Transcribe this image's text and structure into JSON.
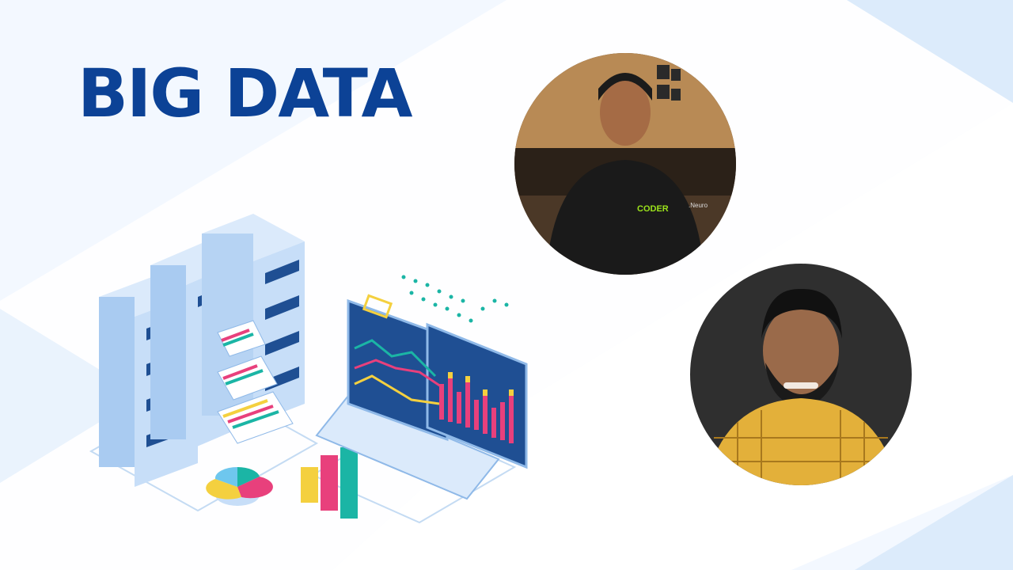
{
  "slide": {
    "title": "BIG DATA",
    "title_color": "#0c4296",
    "background_color": "#f3f8ff",
    "accent_band_color": "#dcebfb"
  },
  "illustration": {
    "subject": "server racks, laptop with line and bar charts, pie chart and 3D bar chart",
    "colors": {
      "server": "#bfd9f5",
      "server_dark": "#8fb9e8",
      "screen": "#1f4f93",
      "pink": "#e8407c",
      "teal": "#1bb5a5",
      "yellow": "#f4d03f"
    }
  },
  "speakers": [
    {
      "photo": "speaker-1-photo",
      "shirt_text": "CODER",
      "sleeve_text": ".Neuro"
    },
    {
      "photo": "speaker-2-photo"
    }
  ]
}
